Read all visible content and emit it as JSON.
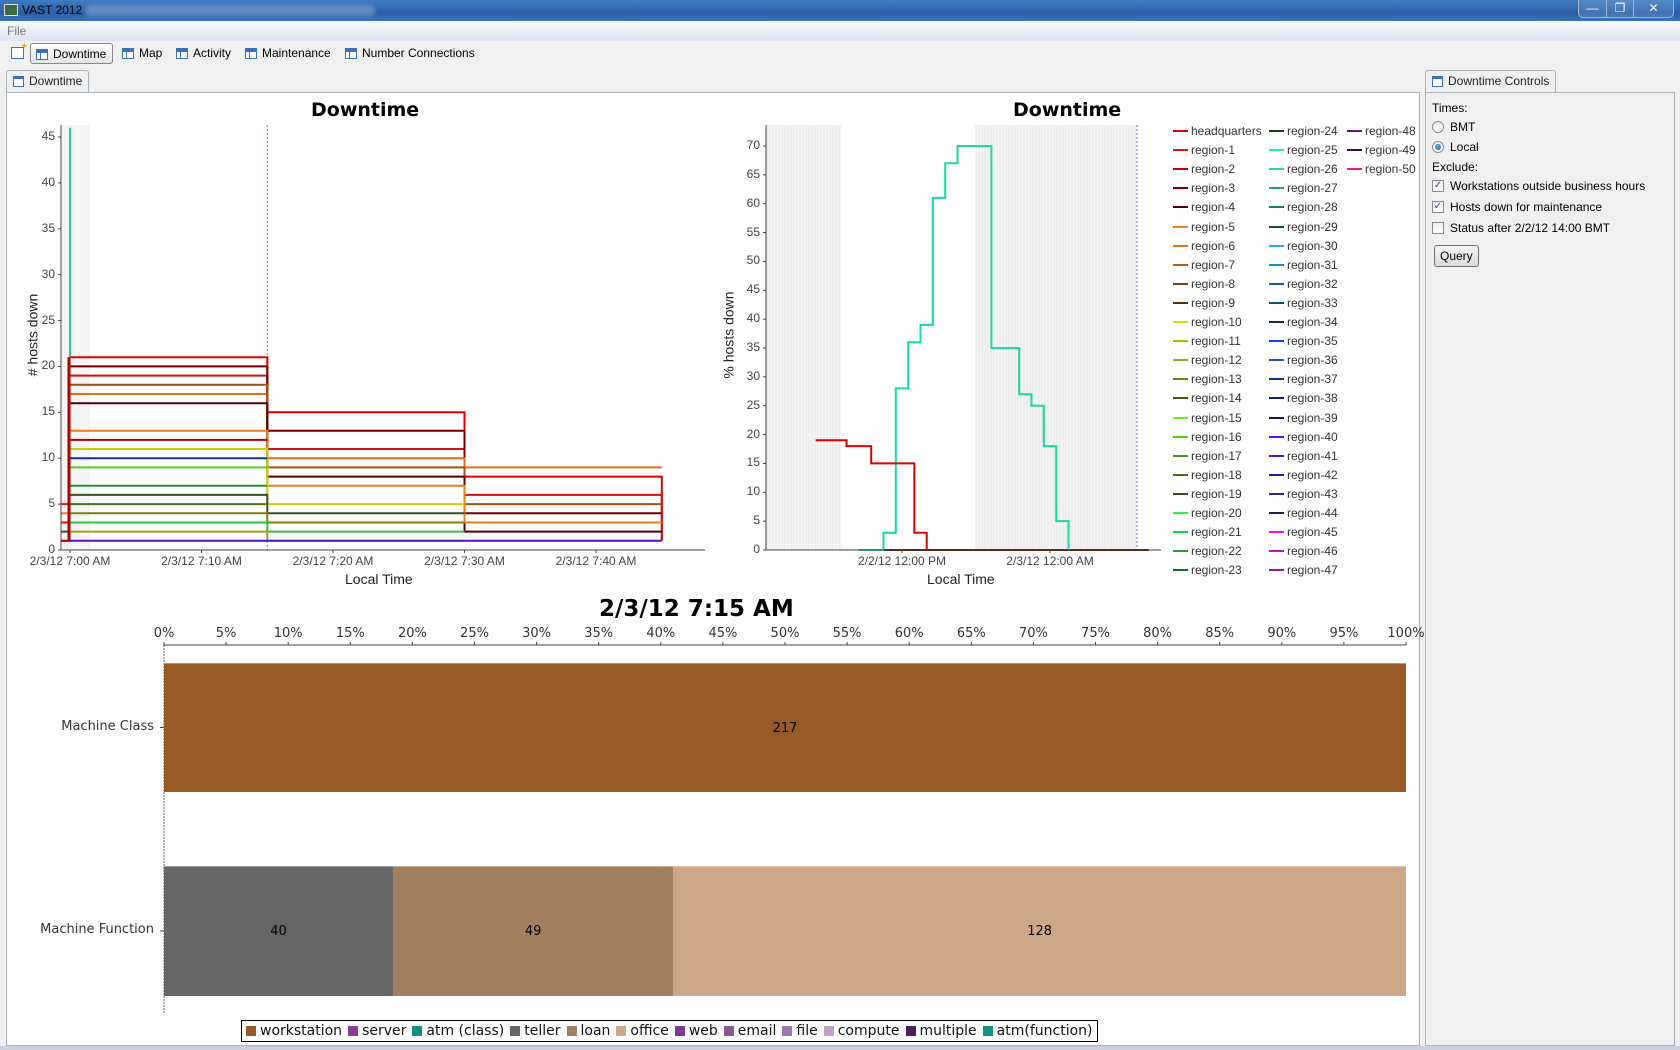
{
  "window": {
    "title": "VAST 2012",
    "controls": {
      "minimize": "—",
      "restore": "❐",
      "close": "✕"
    }
  },
  "menu": {
    "file": "File"
  },
  "toolbar": {
    "items": [
      {
        "label": "Downtime",
        "icon": "view-icon",
        "active": true
      },
      {
        "label": "Map",
        "icon": "view-icon",
        "active": false
      },
      {
        "label": "Activity",
        "icon": "view-icon",
        "active": false
      },
      {
        "label": "Maintenance",
        "icon": "view-icon",
        "active": false
      },
      {
        "label": "Number Connections",
        "icon": "view-icon",
        "active": false
      }
    ]
  },
  "main_tab": {
    "label": "Downtime"
  },
  "controls_tab": {
    "label": "Downtime Controls"
  },
  "controls": {
    "times_label": "Times:",
    "times_options": [
      {
        "label": "BMT",
        "selected": false
      },
      {
        "label": "Local",
        "selected": true
      }
    ],
    "exclude_label": "Exclude:",
    "exclude_options": [
      {
        "label": "Workstations outside business hours",
        "checked": true
      },
      {
        "label": "Hosts down for maintenance",
        "checked": true
      },
      {
        "label": "Status after 2/2/12 14:00 BMT",
        "checked": false
      }
    ],
    "query_button": "Query"
  },
  "chart_data": [
    {
      "type": "line",
      "title": "Downtime",
      "xlabel": "Local Time",
      "ylabel": "# hosts down",
      "ylim": [
        0,
        46
      ],
      "yticks": [
        "0",
        "5",
        "10",
        "15",
        "20",
        "25",
        "30",
        "35",
        "40",
        "45"
      ],
      "xticks": [
        "2/3/12 7:00 AM",
        "2/3/12 7:10 AM",
        "2/3/12 7:20 AM",
        "2/3/12 7:30 AM",
        "2/3/12 7:40 AM"
      ],
      "xlim_minutes": [
        -1,
        50
      ],
      "marker_minute": 15,
      "step": true,
      "series": [
        {
          "name": "region-25",
          "color": "#1ad9a0",
          "points": [
            [
              0,
              46
            ],
            [
              0,
              21
            ]
          ]
        },
        {
          "name": "headquarters",
          "color": "#e00000",
          "points": [
            [
              0,
              21
            ],
            [
              15,
              21
            ],
            [
              15,
              15
            ],
            [
              30,
              15
            ],
            [
              30,
              8
            ],
            [
              45,
              8
            ],
            [
              45,
              1
            ]
          ]
        },
        {
          "name": "region-1",
          "color": "#d01010",
          "points": [
            [
              0,
              19
            ],
            [
              15,
              19
            ],
            [
              15,
              11
            ],
            [
              30,
              11
            ],
            [
              30,
              6
            ],
            [
              45,
              6
            ],
            [
              45,
              1
            ]
          ]
        },
        {
          "name": "region-3",
          "color": "#700000",
          "points": [
            [
              0,
              20
            ],
            [
              15,
              20
            ],
            [
              15,
              13
            ],
            [
              30,
              13
            ],
            [
              30,
              4
            ],
            [
              45,
              4
            ]
          ]
        },
        {
          "name": "region-5",
          "color": "#e07010",
          "points": [
            [
              0,
              17
            ],
            [
              15,
              17
            ],
            [
              15,
              10
            ],
            [
              30,
              10
            ],
            [
              30,
              9
            ],
            [
              45,
              9
            ]
          ]
        },
        {
          "name": "region-7",
          "color": "#a05010",
          "points": [
            [
              0,
              18
            ],
            [
              15,
              18
            ],
            [
              15,
              9
            ],
            [
              30,
              9
            ],
            [
              30,
              5
            ],
            [
              45,
              5
            ]
          ]
        },
        {
          "name": "region-4",
          "color": "#500000",
          "points": [
            [
              0,
              16
            ],
            [
              15,
              16
            ],
            [
              15,
              8
            ],
            [
              30,
              8
            ],
            [
              30,
              2
            ],
            [
              45,
              2
            ]
          ]
        },
        {
          "name": "region-6",
          "color": "#e08020",
          "points": [
            [
              0,
              13
            ],
            [
              15,
              13
            ],
            [
              15,
              7
            ],
            [
              30,
              7
            ],
            [
              30,
              3
            ],
            [
              45,
              3
            ]
          ]
        },
        {
          "name": "region-2",
          "color": "#b00000",
          "points": [
            [
              0,
              12
            ],
            [
              15,
              12
            ]
          ]
        },
        {
          "name": "region-10",
          "color": "#c8d000",
          "points": [
            [
              0,
              11
            ],
            [
              15,
              11
            ],
            [
              15,
              5
            ],
            [
              30,
              5
            ]
          ]
        },
        {
          "name": "region-37",
          "color": "#1030a0",
          "points": [
            [
              0,
              10
            ],
            [
              15,
              10
            ]
          ]
        },
        {
          "name": "region-15",
          "color": "#50d020",
          "points": [
            [
              0,
              9
            ],
            [
              15,
              9
            ]
          ]
        },
        {
          "name": "region-22",
          "color": "#209040",
          "points": [
            [
              0,
              7
            ],
            [
              15,
              7
            ]
          ]
        },
        {
          "name": "region-19",
          "color": "#305020",
          "points": [
            [
              0,
              6
            ],
            [
              15,
              6
            ],
            [
              15,
              4
            ],
            [
              30,
              4
            ]
          ]
        },
        {
          "name": "region-18",
          "color": "#507020",
          "points": [
            [
              0,
              5
            ],
            [
              15,
              5
            ]
          ]
        },
        {
          "name": "region-13",
          "color": "#7a8010",
          "points": [
            [
              0,
              4
            ],
            [
              15,
              4
            ],
            [
              15,
              3
            ],
            [
              30,
              3
            ]
          ]
        },
        {
          "name": "region-20",
          "color": "#30c040",
          "points": [
            [
              0,
              3
            ],
            [
              15,
              3
            ],
            [
              15,
              2
            ],
            [
              30,
              2
            ]
          ]
        },
        {
          "name": "region-12",
          "color": "#a0a020",
          "points": [
            [
              0,
              2
            ],
            [
              15,
              2
            ],
            [
              15,
              1
            ],
            [
              30,
              1
            ]
          ]
        },
        {
          "name": "region-40",
          "color": "#5010d0",
          "points": [
            [
              0,
              1
            ],
            [
              15,
              1
            ],
            [
              30,
              1
            ],
            [
              45,
              1
            ]
          ]
        }
      ]
    },
    {
      "type": "line",
      "title": "Downtime",
      "xlabel": "Local Time",
      "ylabel": "% hosts down",
      "ylim": [
        0,
        73
      ],
      "yticks": [
        "0",
        "5",
        "10",
        "15",
        "20",
        "25",
        "30",
        "35",
        "40",
        "45",
        "50",
        "55",
        "60",
        "65",
        "70"
      ],
      "xticks": [
        "2/2/12 12:00 PM",
        "2/3/12 12:00 AM"
      ],
      "step": true,
      "series": [
        {
          "name": "headquarters",
          "color": "#e00000",
          "points": [
            [
              "2/2/12 05:00",
              19
            ],
            [
              "2/2/12 07:30",
              19
            ],
            [
              "2/2/12 07:30",
              18
            ],
            [
              "2/2/12 09:30",
              18
            ],
            [
              "2/2/12 09:30",
              15
            ],
            [
              "2/2/12 13:00",
              15
            ],
            [
              "2/2/12 13:00",
              3
            ],
            [
              "2/2/12 14:00",
              3
            ],
            [
              "2/2/12 14:00",
              0
            ]
          ]
        },
        {
          "name": "region-25",
          "color": "#1ad9a0",
          "points": [
            [
              "2/2/12 08:30",
              0
            ],
            [
              "2/2/12 10:30",
              0
            ],
            [
              "2/2/12 10:30",
              3
            ],
            [
              "2/2/12 11:30",
              3
            ],
            [
              "2/2/12 11:30",
              28
            ],
            [
              "2/2/12 12:30",
              28
            ],
            [
              "2/2/12 12:30",
              36
            ],
            [
              "2/2/12 13:30",
              36
            ],
            [
              "2/2/12 13:30",
              39
            ],
            [
              "2/2/12 14:30",
              39
            ],
            [
              "2/2/12 14:30",
              61
            ],
            [
              "2/2/12 15:30",
              61
            ],
            [
              "2/2/12 15:30",
              67
            ],
            [
              "2/2/12 16:30",
              67
            ],
            [
              "2/2/12 16:30",
              70
            ],
            [
              "2/2/12 19:15",
              70
            ],
            [
              "2/2/12 19:15",
              35
            ],
            [
              "2/2/12 21:30",
              35
            ],
            [
              "2/2/12 21:30",
              27
            ],
            [
              "2/2/12 22:30",
              27
            ],
            [
              "2/2/12 22:30",
              25
            ],
            [
              "2/2/12 23:30",
              25
            ],
            [
              "2/2/12 23:30",
              18
            ],
            [
              "2/3/12 00:30",
              18
            ],
            [
              "2/3/12 00:30",
              5
            ],
            [
              "2/3/12 01:30",
              5
            ],
            [
              "2/3/12 01:30",
              0
            ]
          ]
        },
        {
          "name": "region-4",
          "color": "#701000",
          "points": [
            [
              "2/2/12 08:30",
              0
            ],
            [
              "2/3/12 08:00",
              0
            ]
          ]
        }
      ],
      "legend": [
        {
          "name": "headquarters",
          "color": "#e00000"
        },
        {
          "name": "region-1",
          "color": "#e01010"
        },
        {
          "name": "region-2",
          "color": "#c00000"
        },
        {
          "name": "region-3",
          "color": "#800000"
        },
        {
          "name": "region-4",
          "color": "#500000"
        },
        {
          "name": "region-5",
          "color": "#f08010"
        },
        {
          "name": "region-6",
          "color": "#e07010"
        },
        {
          "name": "region-7",
          "color": "#b06010"
        },
        {
          "name": "region-8",
          "color": "#7a4010"
        },
        {
          "name": "region-9",
          "color": "#5a3010"
        },
        {
          "name": "region-10",
          "color": "#d0e000"
        },
        {
          "name": "region-11",
          "color": "#b0b800"
        },
        {
          "name": "region-12",
          "color": "#a0a020"
        },
        {
          "name": "region-13",
          "color": "#7a7a10"
        },
        {
          "name": "region-14",
          "color": "#505010"
        },
        {
          "name": "region-15",
          "color": "#60f020"
        },
        {
          "name": "region-16",
          "color": "#50d010"
        },
        {
          "name": "region-17",
          "color": "#40a010"
        },
        {
          "name": "region-18",
          "color": "#407020"
        },
        {
          "name": "region-19",
          "color": "#305020"
        },
        {
          "name": "region-20",
          "color": "#30f040"
        },
        {
          "name": "region-21",
          "color": "#20d040"
        },
        {
          "name": "region-22",
          "color": "#20a030"
        },
        {
          "name": "region-23",
          "color": "#107020"
        },
        {
          "name": "region-24",
          "color": "#104010"
        },
        {
          "name": "region-25",
          "color": "#20e8b0"
        },
        {
          "name": "region-26",
          "color": "#20d8a0"
        },
        {
          "name": "region-27",
          "color": "#20a080"
        },
        {
          "name": "region-28",
          "color": "#108060"
        },
        {
          "name": "region-29",
          "color": "#105040"
        },
        {
          "name": "region-30",
          "color": "#20b0f0"
        },
        {
          "name": "region-31",
          "color": "#1090d0"
        },
        {
          "name": "region-32",
          "color": "#106090"
        },
        {
          "name": "region-33",
          "color": "#105070"
        },
        {
          "name": "region-34",
          "color": "#103040"
        },
        {
          "name": "region-35",
          "color": "#1040f0"
        },
        {
          "name": "region-36",
          "color": "#2050d0"
        },
        {
          "name": "region-37",
          "color": "#1030a0"
        },
        {
          "name": "region-38",
          "color": "#102070"
        },
        {
          "name": "region-39",
          "color": "#101850"
        },
        {
          "name": "region-40",
          "color": "#6010f0"
        },
        {
          "name": "region-41",
          "color": "#5010d0"
        },
        {
          "name": "region-42",
          "color": "#4010a0"
        },
        {
          "name": "region-43",
          "color": "#402080"
        },
        {
          "name": "region-44",
          "color": "#301850"
        },
        {
          "name": "region-45",
          "color": "#f010f0"
        },
        {
          "name": "region-46",
          "color": "#c010c0"
        },
        {
          "name": "region-47",
          "color": "#a010a0"
        },
        {
          "name": "region-48",
          "color": "#701070"
        },
        {
          "name": "region-49",
          "color": "#400840"
        },
        {
          "name": "region-50",
          "color": "#f0108a"
        }
      ]
    },
    {
      "type": "bar",
      "orientation": "horizontal-stacked-percent",
      "title": "2/3/12 7:15 AM",
      "xticks": [
        "0%",
        "5%",
        "10%",
        "15%",
        "20%",
        "25%",
        "30%",
        "35%",
        "40%",
        "45%",
        "50%",
        "55%",
        "60%",
        "65%",
        "70%",
        "75%",
        "80%",
        "85%",
        "90%",
        "95%",
        "100%"
      ],
      "categories": [
        "Machine Class",
        "Machine Function"
      ],
      "series": [
        {
          "name": "workstation",
          "color": "#985a27",
          "values": [
            217,
            0
          ]
        },
        {
          "name": "server",
          "color": "#8e3a96",
          "values": [
            0,
            0
          ]
        },
        {
          "name": "atm (class)",
          "color": "#129480",
          "values": [
            0,
            0
          ]
        },
        {
          "name": "teller",
          "color": "#666666",
          "values": [
            0,
            40
          ]
        },
        {
          "name": "loan",
          "color": "#a27f5f",
          "values": [
            0,
            49
          ]
        },
        {
          "name": "office",
          "color": "#cca888",
          "values": [
            0,
            128
          ]
        },
        {
          "name": "web",
          "color": "#7e3a8a",
          "values": [
            0,
            0
          ]
        },
        {
          "name": "email",
          "color": "#885a8e",
          "values": [
            0,
            0
          ]
        },
        {
          "name": "file",
          "color": "#9e76b0",
          "values": [
            0,
            0
          ]
        },
        {
          "name": "compute",
          "color": "#c0a2c8",
          "values": [
            0,
            0
          ]
        },
        {
          "name": "multiple",
          "color": "#4e1e5e",
          "values": [
            0,
            0
          ]
        },
        {
          "name": "atm(function)",
          "color": "#129480",
          "values": [
            0,
            0
          ]
        }
      ]
    }
  ]
}
